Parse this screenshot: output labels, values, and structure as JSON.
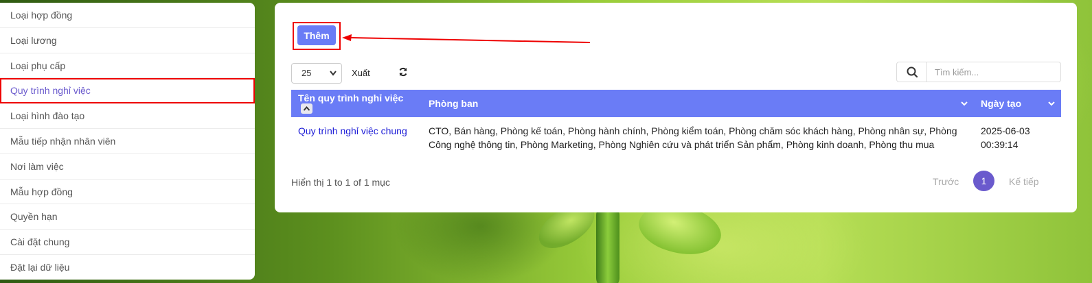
{
  "sidebar": {
    "items": [
      {
        "label": "Loại hợp đồng"
      },
      {
        "label": "Loại lương"
      },
      {
        "label": "Loại phụ cấp"
      },
      {
        "label": "Quy trình nghỉ việc",
        "active": true
      },
      {
        "label": "Loại hình đào tạo"
      },
      {
        "label": "Mẫu tiếp nhận nhân viên"
      },
      {
        "label": "Nơi làm việc"
      },
      {
        "label": "Mẫu hợp đồng"
      },
      {
        "label": "Quyền hạn"
      },
      {
        "label": "Cài đặt chung"
      },
      {
        "label": "Đặt lại dữ liệu"
      }
    ]
  },
  "toolbar": {
    "add_label": "Thêm",
    "page_size": "25",
    "export_label": "Xuất",
    "search_placeholder": "Tìm kiếm..."
  },
  "table": {
    "headers": [
      "Tên quy trình nghỉ việc",
      "Phòng ban",
      "Ngày tạo"
    ],
    "rows": [
      {
        "name": "Quy trình nghỉ việc chung",
        "departments": "CTO, Bán hàng, Phòng kế toán, Phòng hành chính, Phòng kiểm toán, Phòng chăm sóc khách hàng, Phòng nhân sự, Phòng Công nghệ thông tin, Phòng Marketing, Phòng Nghiên cứu và phát triển Sản phẩm, Phòng kinh doanh, Phòng thu mua",
        "created_date": "2025-06-03",
        "created_time": "00:39:14"
      }
    ]
  },
  "footer": {
    "info": "Hiển thị 1 to 1 of 1 mục",
    "prev_label": "Trước",
    "current_page": "1",
    "next_label": "Kế tiếp"
  },
  "colors": {
    "accent": "#6a7cf6",
    "active_menu": "#6a5acd",
    "highlight": "#ee0000"
  }
}
